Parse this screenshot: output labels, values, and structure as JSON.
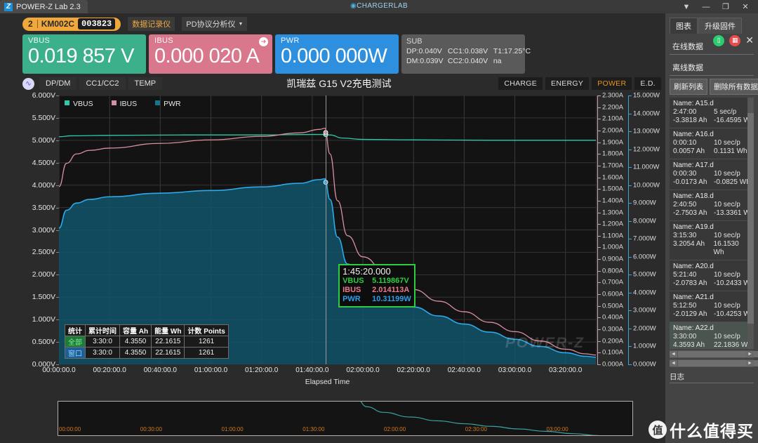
{
  "titlebar": {
    "tab_label": "POWER-Z Lab 2.3",
    "center_brand": "CHARGERLAB",
    "center_brand_pre": "C",
    "controls": [
      "▼",
      "—",
      "❐",
      "✕"
    ]
  },
  "device": {
    "port": "2",
    "model": "KM002C",
    "serial": "003823",
    "btn_recorder": "数据记录仪",
    "btn_pd": "PD协议分析仪",
    "caret": "▼"
  },
  "readouts": {
    "vbus": {
      "label": "VBUS",
      "value": "0.019 857 V",
      "color": "#3cb08a"
    },
    "ibus": {
      "label": "IBUS",
      "value": "0.000 020 A",
      "color": "#d9788c",
      "icon": "arrow-right-icon"
    },
    "pwr": {
      "label": "PWR",
      "value": "0.000 000W",
      "color": "#2d8fdd"
    },
    "sub": {
      "label": "SUB",
      "dp": "DP:0.040V",
      "cc1": "CC1:0.038V",
      "t1": "T1:17.25°C",
      "dm": "DM:0.039V",
      "cc2": "CC2:0.040V",
      "na": "na"
    }
  },
  "chart_toolbar": {
    "wave_icon": "waveform-icon",
    "tabs": [
      "DP/DM",
      "CC1/CC2",
      "TEMP"
    ],
    "title": "凯瑞兹 G15 V2充电测试",
    "right_buttons": [
      {
        "label": "CHARGE",
        "active": false
      },
      {
        "label": "ENERGY",
        "active": false
      },
      {
        "label": "POWER",
        "active": true
      },
      {
        "label": "E.D.",
        "active": false
      }
    ]
  },
  "chart_data": {
    "type": "line",
    "title": "凯瑞兹 G15 V2充电测试",
    "xlabel": "Elapsed Time",
    "grid": true,
    "legend_position": "top-left",
    "x_ticks": [
      "00:00:00.0",
      "00:20:00.0",
      "00:40:00.0",
      "01:00:00.0",
      "01:20:00.0",
      "01:40:00.0",
      "02:00:00.0",
      "02:20:00.0",
      "02:40:00.0",
      "03:00:00.0",
      "03:20:00.0"
    ],
    "xlim_minutes": [
      0,
      212
    ],
    "axes": [
      {
        "name": "VBUS",
        "unit": "V",
        "color": "#2ecaa8",
        "lim": [
          0,
          6
        ],
        "ticks": [
          "0.000V",
          "0.500V",
          "1.000V",
          "1.500V",
          "2.000V",
          "2.500V",
          "3.000V",
          "3.500V",
          "4.000V",
          "4.500V",
          "5.000V",
          "5.500V",
          "6.000V"
        ]
      },
      {
        "name": "IBUS",
        "unit": "A",
        "color": "#c9a0ad",
        "lim": [
          0,
          2.3
        ],
        "ticks": [
          "0.000A",
          "0.100A",
          "0.200A",
          "0.300A",
          "0.400A",
          "0.500A",
          "0.600A",
          "0.700A",
          "0.800A",
          "0.900A",
          "1.000A",
          "1.100A",
          "1.200A",
          "1.300A",
          "1.400A",
          "1.500A",
          "1.600A",
          "1.700A",
          "1.800A",
          "1.900A",
          "2.000A",
          "2.100A",
          "2.200A",
          "2.300A"
        ]
      },
      {
        "name": "PWR",
        "unit": "W",
        "color": "#37a7d8",
        "lim": [
          0,
          15
        ],
        "ticks": [
          "0.000W",
          "1.000W",
          "2.000W",
          "3.000W",
          "4.000W",
          "5.000W",
          "6.000W",
          "7.000W",
          "8.000W",
          "9.000W",
          "10.000W",
          "11.000W",
          "12.000W",
          "13.000W",
          "14.000W",
          "15.000W"
        ]
      }
    ],
    "series": [
      {
        "name": "VBUS",
        "color": "#2ecaa8",
        "unit": "V",
        "points": [
          [
            0,
            5.08
          ],
          [
            5,
            5.1
          ],
          [
            20,
            5.11
          ],
          [
            50,
            5.12
          ],
          [
            80,
            5.12
          ],
          [
            100,
            5.13
          ],
          [
            105,
            5.13
          ],
          [
            107,
            5.12
          ],
          [
            112,
            5.05
          ],
          [
            120,
            5.02
          ],
          [
            140,
            5.01
          ],
          [
            170,
            5.0
          ],
          [
            212,
            5.0
          ]
        ]
      },
      {
        "name": "IBUS",
        "color": "#d98fa2",
        "unit": "A",
        "points": [
          [
            0,
            1.52
          ],
          [
            3,
            1.72
          ],
          [
            7,
            1.8
          ],
          [
            12,
            1.83
          ],
          [
            20,
            1.85
          ],
          [
            40,
            1.89
          ],
          [
            60,
            1.92
          ],
          [
            80,
            1.95
          ],
          [
            95,
            1.98
          ],
          [
            103,
            2.01
          ],
          [
            105,
            2.02
          ],
          [
            107,
            1.8
          ],
          [
            110,
            1.4
          ],
          [
            114,
            1.1
          ],
          [
            120,
            0.92
          ],
          [
            130,
            0.76
          ],
          [
            140,
            0.64
          ],
          [
            150,
            0.54
          ],
          [
            160,
            0.45
          ],
          [
            170,
            0.36
          ],
          [
            180,
            0.28
          ],
          [
            190,
            0.2
          ],
          [
            200,
            0.13
          ],
          [
            208,
            0.09
          ],
          [
            212,
            0.08
          ]
        ]
      },
      {
        "name": "PWR",
        "color": "#2ea8e8",
        "unit": "W",
        "filled": true,
        "points": [
          [
            0,
            7.6
          ],
          [
            3,
            8.6
          ],
          [
            7,
            9.0
          ],
          [
            12,
            9.2
          ],
          [
            20,
            9.35
          ],
          [
            40,
            9.55
          ],
          [
            60,
            9.7
          ],
          [
            80,
            9.9
          ],
          [
            95,
            10.1
          ],
          [
            103,
            10.31
          ],
          [
            105,
            10.35
          ],
          [
            107,
            9.2
          ],
          [
            110,
            7.1
          ],
          [
            114,
            5.6
          ],
          [
            120,
            4.65
          ],
          [
            130,
            3.85
          ],
          [
            140,
            3.2
          ],
          [
            150,
            2.7
          ],
          [
            160,
            2.25
          ],
          [
            170,
            1.8
          ],
          [
            180,
            1.4
          ],
          [
            190,
            1.0
          ],
          [
            200,
            0.65
          ],
          [
            208,
            0.45
          ],
          [
            212,
            0.4
          ]
        ]
      }
    ],
    "cursor": {
      "x_minutes": 105.33
    },
    "tooltip": {
      "time": "1:45:20.000",
      "rows": [
        {
          "key": "VBUS",
          "value": "5.119867V",
          "color": "#2ecc40"
        },
        {
          "key": "IBUS",
          "value": "2.014113A",
          "color": "#e87a8e"
        },
        {
          "key": "PWR",
          "value": "10.31199W",
          "color": "#2d9fe8"
        }
      ]
    },
    "stats_table": {
      "headers": [
        "统计",
        "累计时间",
        "容量 Ah",
        "能量 Wh",
        "计数 Points"
      ],
      "rows": [
        {
          "tag": "全部",
          "time": "3:30:0",
          "ah": "4.3550",
          "wh": "22.1615",
          "points": "1261"
        },
        {
          "tag": "窗口",
          "time": "3:30:0",
          "ah": "4.3550",
          "wh": "22.1615",
          "points": "1261"
        }
      ]
    },
    "watermark": "POWER-Z"
  },
  "overview": {
    "ticks": [
      "00:00:00",
      "00:30:00",
      "01:00:00",
      "01:30:00",
      "02:00:00",
      "02:30:00",
      "03:00:00"
    ]
  },
  "sidebar": {
    "tabs": [
      {
        "label": "图表",
        "active": true
      },
      {
        "label": "升级固件",
        "active": false
      }
    ],
    "group_online": "在线数据",
    "group_offline": "离线数据",
    "btn_refresh": "刷新列表",
    "btn_delete_all": "删除所有数据",
    "items": [
      {
        "name": "Name: A15.d",
        "time": "2:47:00",
        "rate": "5 sec/p",
        "ah": "-3.3818 Ah",
        "wh": "-16.4595 W",
        "selected": false
      },
      {
        "name": "Name: A16.d",
        "time": "0:00:10",
        "rate": "10 sec/p",
        "ah": "0.0057 Ah",
        "wh": "0.1131 Wh",
        "selected": false
      },
      {
        "name": "Name: A17.d",
        "time": "0:00:30",
        "rate": "10 sec/p",
        "ah": "-0.0173 Ah",
        "wh": "-0.0825 WI",
        "selected": false
      },
      {
        "name": "Name: A18.d",
        "time": "2:40:50",
        "rate": "10 sec/p",
        "ah": "-2.7503 Ah",
        "wh": "-13.3361 W",
        "selected": false
      },
      {
        "name": "Name: A19.d",
        "time": "3:15:30",
        "rate": "10 sec/p",
        "ah": "3.2054 Ah",
        "wh": "16.1530 Wh",
        "selected": false
      },
      {
        "name": "Name: A20.d",
        "time": "5:21:40",
        "rate": "10 sec/p",
        "ah": "-2.0783 Ah",
        "wh": "-10.2433 W",
        "selected": false
      },
      {
        "name": "Name: A21.d",
        "time": "5:12:50",
        "rate": "10 sec/p",
        "ah": "-2.0129 Ah",
        "wh": "-10.4253 W",
        "selected": false
      },
      {
        "name": "Name: A22.d",
        "time": "3:30:00",
        "rate": "10 sec/p",
        "ah": "4.3593 Ah",
        "wh": "22.1836 WI",
        "selected": true
      }
    ],
    "log_label": "日志",
    "icons": {
      "battery": "battery-icon",
      "grid": "grid-icon",
      "close": "close-icon"
    }
  },
  "watermark_brand": {
    "mark": "值",
    "text": "什么值得买"
  }
}
